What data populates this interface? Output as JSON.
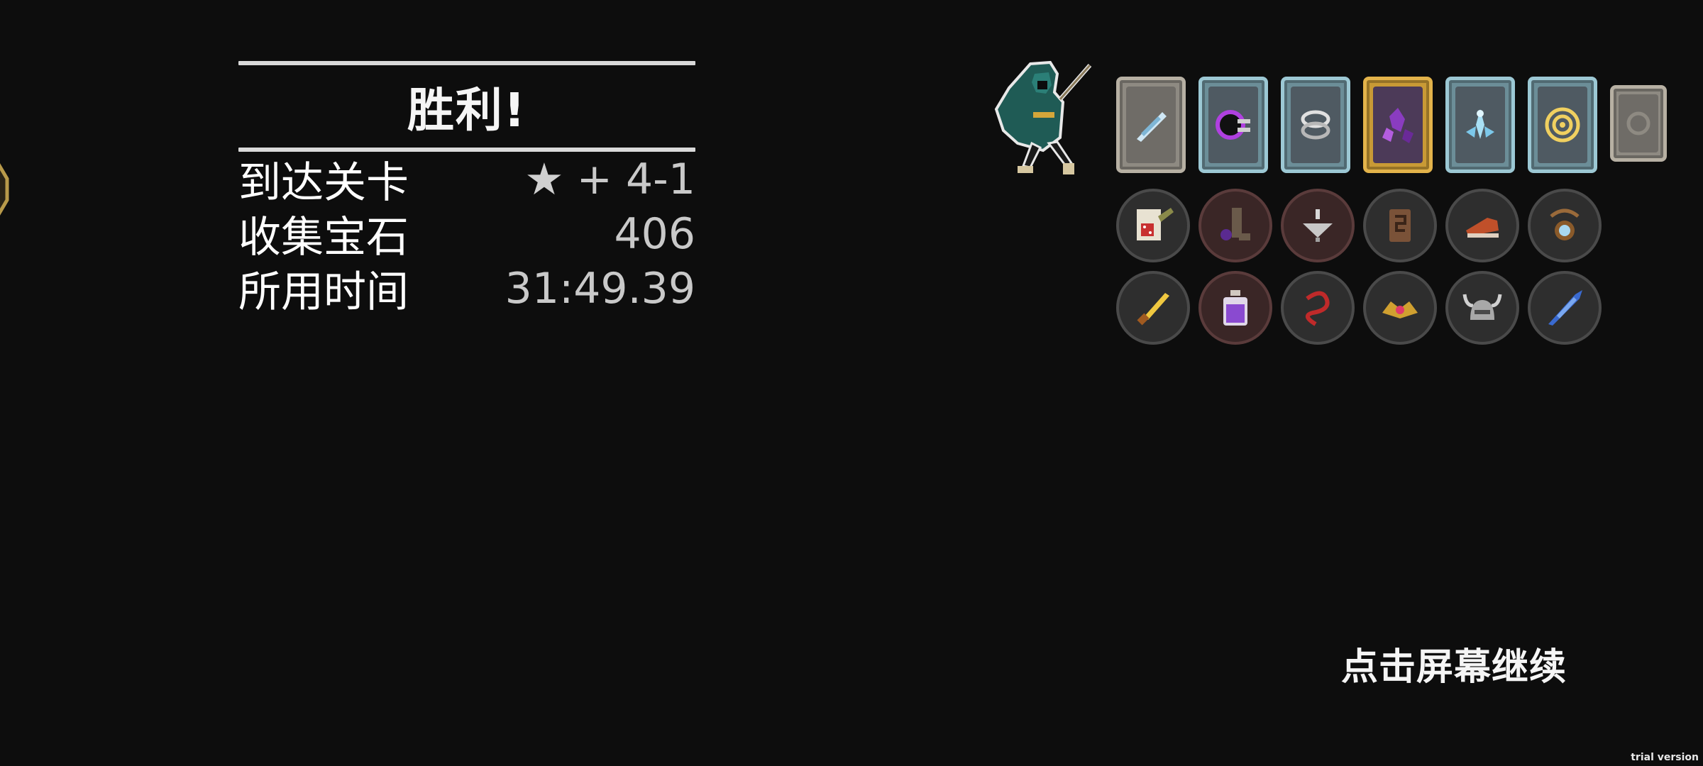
{
  "panel": {
    "title": "胜利!",
    "stats": [
      {
        "label": "到达关卡",
        "value": "+ 4-1",
        "icon": "star-icon"
      },
      {
        "label": "收集宝石",
        "value": "406"
      },
      {
        "label": "所用时间",
        "value": "31:49.39"
      }
    ]
  },
  "icons": {
    "star": "★"
  },
  "cards": [
    {
      "icon": "feather-blade-icon",
      "style": "gray"
    },
    {
      "icon": "void-orb-icon",
      "style": "blue"
    },
    {
      "icon": "chain-swirl-icon",
      "style": "blue"
    },
    {
      "icon": "purple-crystal-icon",
      "style": "gold"
    },
    {
      "icon": "ice-shard-icon",
      "style": "blue"
    },
    {
      "icon": "golden-spiral-icon",
      "style": "blue"
    },
    {
      "icon": "empty-card-icon",
      "style": "gray-small"
    }
  ],
  "items": [
    {
      "icon": "scroll-dice-icon"
    },
    {
      "icon": "dark-flask-icon",
      "style": "red"
    },
    {
      "icon": "silver-top-icon",
      "style": "red"
    },
    {
      "icon": "wooden-rune-icon"
    },
    {
      "icon": "red-boot-icon"
    },
    {
      "icon": "amulet-icon"
    },
    {
      "icon": "golden-dagger-icon"
    },
    {
      "icon": "purple-potion-icon",
      "style": "red"
    },
    {
      "icon": "red-ribbon-icon"
    },
    {
      "icon": "jeweled-crown-icon"
    },
    {
      "icon": "horned-helmet-icon"
    },
    {
      "icon": "blue-quill-icon"
    }
  ],
  "continue_text": "点击屏幕继续",
  "watermark": "trial version",
  "colors": {
    "background": "#0d0d0d",
    "gold": "#e3b34a",
    "card_blue": "#9cc8d4"
  }
}
